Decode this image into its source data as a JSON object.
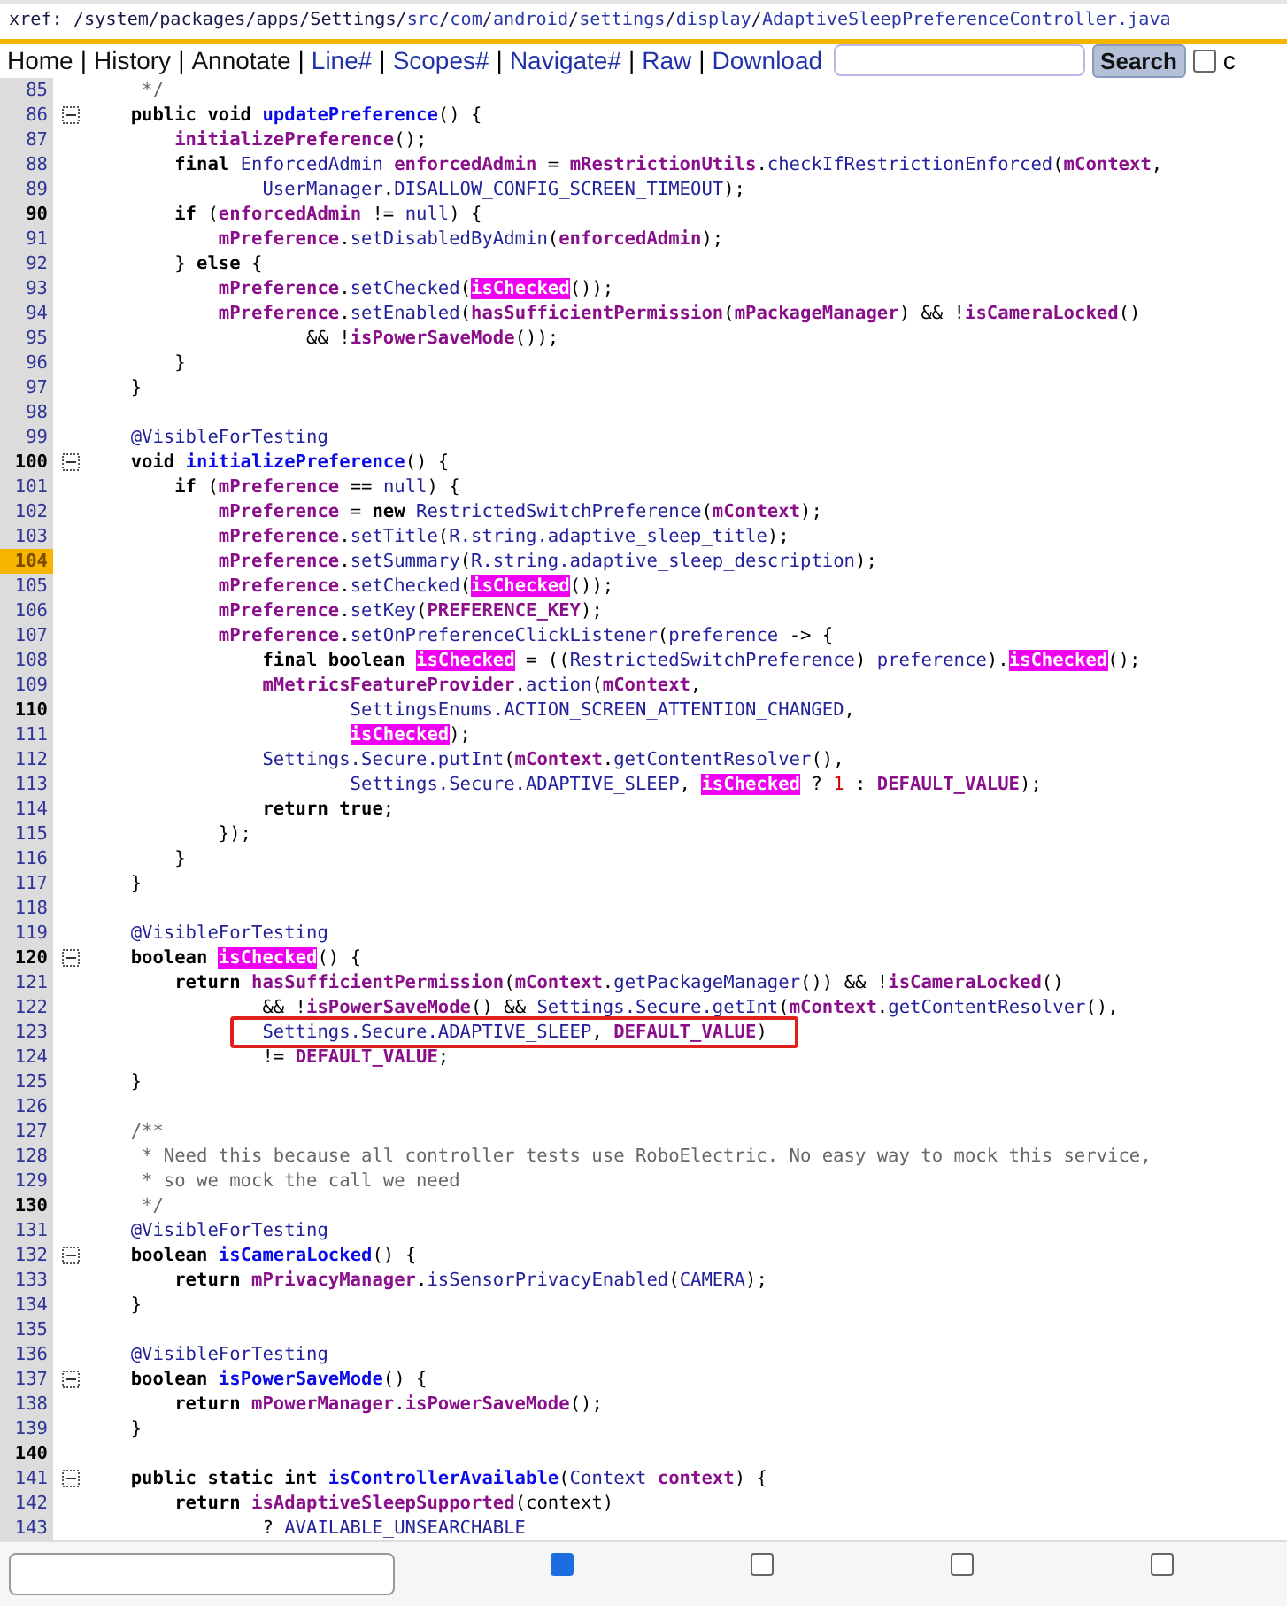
{
  "path": [
    {
      "text": "xref: /system/packages/apps/Settings/",
      "link": false
    },
    {
      "text": "src",
      "link": true
    },
    {
      "text": "/",
      "link": false
    },
    {
      "text": "com",
      "link": true
    },
    {
      "text": "/",
      "link": false
    },
    {
      "text": "android",
      "link": true
    },
    {
      "text": "/",
      "link": false
    },
    {
      "text": "settings",
      "link": true
    },
    {
      "text": "/",
      "link": false
    },
    {
      "text": "display",
      "link": true
    },
    {
      "text": "/",
      "link": false
    },
    {
      "text": "AdaptiveSleepPreferenceController.java",
      "link": true
    }
  ],
  "nav": [
    {
      "kind": "page",
      "label": "Home"
    },
    {
      "kind": "sep",
      "label": "|"
    },
    {
      "kind": "page",
      "label": "History"
    },
    {
      "kind": "sep",
      "label": "|"
    },
    {
      "kind": "page",
      "label": "Annotate"
    },
    {
      "kind": "sep",
      "label": "|"
    },
    {
      "kind": "link",
      "label": "Line#"
    },
    {
      "kind": "sep",
      "label": "|"
    },
    {
      "kind": "link",
      "label": "Scopes#"
    },
    {
      "kind": "sep",
      "label": "|"
    },
    {
      "kind": "link",
      "label": "Navigate#"
    },
    {
      "kind": "sep",
      "label": "|"
    },
    {
      "kind": "link",
      "label": "Raw"
    },
    {
      "kind": "sep",
      "label": "|"
    },
    {
      "kind": "link",
      "label": "Download"
    }
  ],
  "search": {
    "button": "Search",
    "checked": false,
    "option_label": "c"
  },
  "lines": [
    {
      "n": "85",
      "kind": "plain",
      "fold": false,
      "tokens": [
        {
          "t": "     */",
          "kind": "c"
        }
      ]
    },
    {
      "n": "86",
      "kind": "plain",
      "fold": true,
      "tokens": [
        {
          "t": "    public void ",
          "kind": "kw"
        },
        {
          "t": "updatePreference",
          "kind": "fn"
        },
        {
          "t": "() {",
          "kind": "p"
        }
      ]
    },
    {
      "n": "87",
      "kind": "plain",
      "fold": false,
      "tokens": [
        {
          "t": "        initializePreference",
          "kind": "f"
        },
        {
          "t": "();",
          "kind": "p"
        }
      ]
    },
    {
      "n": "88",
      "kind": "plain",
      "fold": false,
      "tokens": [
        {
          "t": "        final ",
          "kind": "kw"
        },
        {
          "t": "EnforcedAdmin ",
          "kind": "id"
        },
        {
          "t": "enforcedAdmin",
          "kind": "f"
        },
        {
          "t": " = ",
          "kind": "p"
        },
        {
          "t": "mRestrictionUtils",
          "kind": "f"
        },
        {
          "t": ".",
          "kind": "p"
        },
        {
          "t": "checkIfRestrictionEnforced",
          "kind": "id"
        },
        {
          "t": "(",
          "kind": "p"
        },
        {
          "t": "mContext",
          "kind": "f"
        },
        {
          "t": ",",
          "kind": "p"
        }
      ]
    },
    {
      "n": "89",
      "kind": "plain",
      "fold": false,
      "tokens": [
        {
          "t": "                UserManager",
          "kind": "id"
        },
        {
          "t": ".",
          "kind": "p"
        },
        {
          "t": "DISALLOW_CONFIG_SCREEN_TIMEOUT",
          "kind": "id"
        },
        {
          "t": ");",
          "kind": "p"
        }
      ]
    },
    {
      "n": "90",
      "kind": "bold",
      "fold": false,
      "tokens": [
        {
          "t": "        if",
          "kind": "kw"
        },
        {
          "t": " (",
          "kind": "p"
        },
        {
          "t": "enforcedAdmin",
          "kind": "f"
        },
        {
          "t": " != ",
          "kind": "p"
        },
        {
          "t": "null",
          "kind": "id"
        },
        {
          "t": ") {",
          "kind": "p"
        }
      ]
    },
    {
      "n": "91",
      "kind": "plain",
      "fold": false,
      "tokens": [
        {
          "t": "            mPreference",
          "kind": "f"
        },
        {
          "t": ".",
          "kind": "p"
        },
        {
          "t": "setDisabledByAdmin",
          "kind": "id"
        },
        {
          "t": "(",
          "kind": "p"
        },
        {
          "t": "enforcedAdmin",
          "kind": "f"
        },
        {
          "t": ");",
          "kind": "p"
        }
      ]
    },
    {
      "n": "92",
      "kind": "plain",
      "fold": false,
      "tokens": [
        {
          "t": "        } ",
          "kind": "p"
        },
        {
          "t": "else",
          "kind": "kw"
        },
        {
          "t": " {",
          "kind": "p"
        }
      ]
    },
    {
      "n": "93",
      "kind": "plain",
      "fold": false,
      "tokens": [
        {
          "t": "            mPreference",
          "kind": "f"
        },
        {
          "t": ".",
          "kind": "p"
        },
        {
          "t": "setChecked",
          "kind": "id"
        },
        {
          "t": "(",
          "kind": "p"
        },
        {
          "t": "isChecked",
          "kind": "hit"
        },
        {
          "t": "());",
          "kind": "p"
        }
      ]
    },
    {
      "n": "94",
      "kind": "plain",
      "fold": false,
      "tokens": [
        {
          "t": "            mPreference",
          "kind": "f"
        },
        {
          "t": ".",
          "kind": "p"
        },
        {
          "t": "setEnabled",
          "kind": "id"
        },
        {
          "t": "(",
          "kind": "p"
        },
        {
          "t": "hasSufficientPermission",
          "kind": "f"
        },
        {
          "t": "(",
          "kind": "p"
        },
        {
          "t": "mPackageManager",
          "kind": "f"
        },
        {
          "t": ") && !",
          "kind": "p"
        },
        {
          "t": "isCameraLocked",
          "kind": "f"
        },
        {
          "t": "()",
          "kind": "p"
        }
      ]
    },
    {
      "n": "95",
      "kind": "plain",
      "fold": false,
      "tokens": [
        {
          "t": "                    && !",
          "kind": "p"
        },
        {
          "t": "isPowerSaveMode",
          "kind": "f"
        },
        {
          "t": "());",
          "kind": "p"
        }
      ]
    },
    {
      "n": "96",
      "kind": "plain",
      "fold": false,
      "tokens": [
        {
          "t": "        }",
          "kind": "p"
        }
      ]
    },
    {
      "n": "97",
      "kind": "plain",
      "fold": false,
      "tokens": [
        {
          "t": "    }",
          "kind": "p"
        }
      ]
    },
    {
      "n": "98",
      "kind": "plain",
      "fold": false
    },
    {
      "n": "99",
      "kind": "plain",
      "fold": false,
      "tokens": [
        {
          "t": "    @VisibleForTesting",
          "kind": "id"
        }
      ]
    },
    {
      "n": "100",
      "kind": "bold",
      "fold": true,
      "tokens": [
        {
          "t": "    void ",
          "kind": "kw"
        },
        {
          "t": "initializePreference",
          "kind": "fn"
        },
        {
          "t": "() {",
          "kind": "p"
        }
      ]
    },
    {
      "n": "101",
      "kind": "plain",
      "fold": false,
      "tokens": [
        {
          "t": "        if",
          "kind": "kw"
        },
        {
          "t": " (",
          "kind": "p"
        },
        {
          "t": "mPreference",
          "kind": "f"
        },
        {
          "t": " == ",
          "kind": "p"
        },
        {
          "t": "null",
          "kind": "id"
        },
        {
          "t": ") {",
          "kind": "p"
        }
      ]
    },
    {
      "n": "102",
      "kind": "plain",
      "fold": false,
      "tokens": [
        {
          "t": "            mPreference",
          "kind": "f"
        },
        {
          "t": " = ",
          "kind": "p"
        },
        {
          "t": "new ",
          "kind": "kw"
        },
        {
          "t": "RestrictedSwitchPreference",
          "kind": "id"
        },
        {
          "t": "(",
          "kind": "p"
        },
        {
          "t": "mContext",
          "kind": "f"
        },
        {
          "t": ");",
          "kind": "p"
        }
      ]
    },
    {
      "n": "103",
      "kind": "plain",
      "fold": false,
      "tokens": [
        {
          "t": "            mPreference",
          "kind": "f"
        },
        {
          "t": ".",
          "kind": "p"
        },
        {
          "t": "setTitle",
          "kind": "id"
        },
        {
          "t": "(",
          "kind": "p"
        },
        {
          "t": "R.string.adaptive_sleep_title",
          "kind": "id"
        },
        {
          "t": ");",
          "kind": "p"
        }
      ]
    },
    {
      "n": "104",
      "kind": "current",
      "fold": false,
      "tokens": [
        {
          "t": "            mPreference",
          "kind": "f"
        },
        {
          "t": ".",
          "kind": "p"
        },
        {
          "t": "setSummary",
          "kind": "id"
        },
        {
          "t": "(",
          "kind": "p"
        },
        {
          "t": "R.string.adaptive_sleep_description",
          "kind": "id"
        },
        {
          "t": ");",
          "kind": "p"
        }
      ]
    },
    {
      "n": "105",
      "kind": "plain",
      "fold": false,
      "tokens": [
        {
          "t": "            mPreference",
          "kind": "f"
        },
        {
          "t": ".",
          "kind": "p"
        },
        {
          "t": "setChecked",
          "kind": "id"
        },
        {
          "t": "(",
          "kind": "p"
        },
        {
          "t": "isChecked",
          "kind": "hit"
        },
        {
          "t": "());",
          "kind": "p"
        }
      ]
    },
    {
      "n": "106",
      "kind": "plain",
      "fold": false,
      "tokens": [
        {
          "t": "            mPreference",
          "kind": "f"
        },
        {
          "t": ".",
          "kind": "p"
        },
        {
          "t": "setKey",
          "kind": "id"
        },
        {
          "t": "(",
          "kind": "p"
        },
        {
          "t": "PREFERENCE_KEY",
          "kind": "f"
        },
        {
          "t": ");",
          "kind": "p"
        }
      ]
    },
    {
      "n": "107",
      "kind": "plain",
      "fold": false,
      "tokens": [
        {
          "t": "            mPreference",
          "kind": "f"
        },
        {
          "t": ".",
          "kind": "p"
        },
        {
          "t": "setOnPreferenceClickListener",
          "kind": "id"
        },
        {
          "t": "(",
          "kind": "p"
        },
        {
          "t": "preference",
          "kind": "id"
        },
        {
          "t": " -> {",
          "kind": "p"
        }
      ]
    },
    {
      "n": "108",
      "kind": "plain",
      "fold": false,
      "tokens": [
        {
          "t": "                final boolean ",
          "kind": "kw"
        },
        {
          "t": "isChecked",
          "kind": "hit"
        },
        {
          "t": " = ((",
          "kind": "p"
        },
        {
          "t": "RestrictedSwitchPreference",
          "kind": "id"
        },
        {
          "t": ") ",
          "kind": "p"
        },
        {
          "t": "preference",
          "kind": "id"
        },
        {
          "t": ").",
          "kind": "p"
        },
        {
          "t": "isChecked",
          "kind": "hit"
        },
        {
          "t": "();",
          "kind": "p"
        }
      ]
    },
    {
      "n": "109",
      "kind": "plain",
      "fold": false,
      "tokens": [
        {
          "t": "                mMetricsFeatureProvider",
          "kind": "f"
        },
        {
          "t": ".",
          "kind": "p"
        },
        {
          "t": "action",
          "kind": "id"
        },
        {
          "t": "(",
          "kind": "p"
        },
        {
          "t": "mContext",
          "kind": "f"
        },
        {
          "t": ",",
          "kind": "p"
        }
      ]
    },
    {
      "n": "110",
      "kind": "bold",
      "fold": false,
      "tokens": [
        {
          "t": "                        SettingsEnums.ACTION_SCREEN_ATTENTION_CHANGED",
          "kind": "id"
        },
        {
          "t": ",",
          "kind": "p"
        }
      ]
    },
    {
      "n": "111",
      "kind": "plain",
      "fold": false,
      "tokens": [
        {
          "t": "                        isChecked",
          "kind": "hit"
        },
        {
          "t": ");",
          "kind": "p"
        }
      ]
    },
    {
      "n": "112",
      "kind": "plain",
      "fold": false,
      "tokens": [
        {
          "t": "                Settings.Secure.putInt",
          "kind": "id"
        },
        {
          "t": "(",
          "kind": "p"
        },
        {
          "t": "mContext",
          "kind": "f"
        },
        {
          "t": ".",
          "kind": "p"
        },
        {
          "t": "getContentResolver",
          "kind": "id"
        },
        {
          "t": "(),",
          "kind": "p"
        }
      ]
    },
    {
      "n": "113",
      "kind": "plain",
      "fold": false,
      "tokens": [
        {
          "t": "                        Settings.Secure.ADAPTIVE_SLEEP",
          "kind": "id"
        },
        {
          "t": ", ",
          "kind": "p"
        },
        {
          "t": "isChecked",
          "kind": "hit"
        },
        {
          "t": " ? ",
          "kind": "p"
        },
        {
          "t": "1",
          "kind": "n"
        },
        {
          "t": " : ",
          "kind": "p"
        },
        {
          "t": "DEFAULT_VALUE",
          "kind": "f"
        },
        {
          "t": ");",
          "kind": "p"
        }
      ]
    },
    {
      "n": "114",
      "kind": "plain",
      "fold": false,
      "tokens": [
        {
          "t": "                return true",
          "kind": "kw"
        },
        {
          "t": ";",
          "kind": "p"
        }
      ]
    },
    {
      "n": "115",
      "kind": "plain",
      "fold": false,
      "tokens": [
        {
          "t": "            });",
          "kind": "p"
        }
      ]
    },
    {
      "n": "116",
      "kind": "plain",
      "fold": false,
      "tokens": [
        {
          "t": "        }",
          "kind": "p"
        }
      ]
    },
    {
      "n": "117",
      "kind": "plain",
      "fold": false,
      "tokens": [
        {
          "t": "    }",
          "kind": "p"
        }
      ]
    },
    {
      "n": "118",
      "kind": "plain",
      "fold": false
    },
    {
      "n": "119",
      "kind": "plain",
      "fold": false,
      "tokens": [
        {
          "t": "    @VisibleForTesting",
          "kind": "id"
        }
      ]
    },
    {
      "n": "120",
      "kind": "bold",
      "fold": true,
      "tokens": [
        {
          "t": "    boolean ",
          "kind": "kw"
        },
        {
          "t": "isChecked",
          "kind": "hit"
        },
        {
          "t": "() {",
          "kind": "p"
        }
      ]
    },
    {
      "n": "121",
      "kind": "plain",
      "fold": false,
      "tokens": [
        {
          "t": "        return ",
          "kind": "kw"
        },
        {
          "t": "hasSufficientPermission",
          "kind": "f"
        },
        {
          "t": "(",
          "kind": "p"
        },
        {
          "t": "mContext",
          "kind": "f"
        },
        {
          "t": ".",
          "kind": "p"
        },
        {
          "t": "getPackageManager",
          "kind": "id"
        },
        {
          "t": "()) && !",
          "kind": "p"
        },
        {
          "t": "isCameraLocked",
          "kind": "f"
        },
        {
          "t": "()",
          "kind": "p"
        }
      ]
    },
    {
      "n": "122",
      "kind": "plain",
      "fold": false,
      "tokens": [
        {
          "t": "                && !",
          "kind": "p"
        },
        {
          "t": "isPowerSaveMode",
          "kind": "f"
        },
        {
          "t": "() && ",
          "kind": "p"
        },
        {
          "t": "Settings.Secure.getInt",
          "kind": "id"
        },
        {
          "t": "(",
          "kind": "p"
        },
        {
          "t": "mContext",
          "kind": "f"
        },
        {
          "t": ".",
          "kind": "p"
        },
        {
          "t": "getContentResolver",
          "kind": "id"
        },
        {
          "t": "(),",
          "kind": "p"
        }
      ]
    },
    {
      "n": "123",
      "kind": "plain",
      "fold": false,
      "tokens": [
        {
          "kind": "box",
          "children": [
            {
              "t": "                Settings.Secure.ADAPTIVE_SLEEP",
              "kind": "id"
            },
            {
              "t": ", ",
              "kind": "p"
            },
            {
              "t": "DEFAULT_VALUE",
              "kind": "f"
            },
            {
              "t": ")",
              "kind": "p"
            }
          ]
        }
      ]
    },
    {
      "n": "124",
      "kind": "plain",
      "fold": false,
      "tokens": [
        {
          "t": "                != ",
          "kind": "p"
        },
        {
          "t": "DEFAULT_VALUE",
          "kind": "f"
        },
        {
          "t": ";",
          "kind": "p"
        }
      ]
    },
    {
      "n": "125",
      "kind": "plain",
      "fold": false,
      "tokens": [
        {
          "t": "    }",
          "kind": "p"
        }
      ]
    },
    {
      "n": "126",
      "kind": "plain",
      "fold": false
    },
    {
      "n": "127",
      "kind": "plain",
      "fold": false,
      "tokens": [
        {
          "t": "    /**",
          "kind": "c"
        }
      ]
    },
    {
      "n": "128",
      "kind": "plain",
      "fold": false,
      "tokens": [
        {
          "t": "     * Need this because all controller tests use RoboElectric. No easy way to mock this service,",
          "kind": "c"
        }
      ]
    },
    {
      "n": "129",
      "kind": "plain",
      "fold": false,
      "tokens": [
        {
          "t": "     * so we mock the call we need",
          "kind": "c"
        }
      ]
    },
    {
      "n": "130",
      "kind": "bold",
      "fold": false,
      "tokens": [
        {
          "t": "     */",
          "kind": "c"
        }
      ]
    },
    {
      "n": "131",
      "kind": "plain",
      "fold": false,
      "tokens": [
        {
          "t": "    @VisibleForTesting",
          "kind": "id"
        }
      ]
    },
    {
      "n": "132",
      "kind": "plain",
      "fold": true,
      "tokens": [
        {
          "t": "    boolean ",
          "kind": "kw"
        },
        {
          "t": "isCameraLocked",
          "kind": "fn"
        },
        {
          "t": "() {",
          "kind": "p"
        }
      ]
    },
    {
      "n": "133",
      "kind": "plain",
      "fold": false,
      "tokens": [
        {
          "t": "        return ",
          "kind": "kw"
        },
        {
          "t": "mPrivacyManager",
          "kind": "f"
        },
        {
          "t": ".",
          "kind": "p"
        },
        {
          "t": "isSensorPrivacyEnabled",
          "kind": "id"
        },
        {
          "t": "(",
          "kind": "p"
        },
        {
          "t": "CAMERA",
          "kind": "id"
        },
        {
          "t": ");",
          "kind": "p"
        }
      ]
    },
    {
      "n": "134",
      "kind": "plain",
      "fold": false,
      "tokens": [
        {
          "t": "    }",
          "kind": "p"
        }
      ]
    },
    {
      "n": "135",
      "kind": "plain",
      "fold": false
    },
    {
      "n": "136",
      "kind": "plain",
      "fold": false,
      "tokens": [
        {
          "t": "    @VisibleForTesting",
          "kind": "id"
        }
      ]
    },
    {
      "n": "137",
      "kind": "plain",
      "fold": true,
      "tokens": [
        {
          "t": "    boolean ",
          "kind": "kw"
        },
        {
          "t": "isPowerSaveMode",
          "kind": "fn"
        },
        {
          "t": "() {",
          "kind": "p"
        }
      ]
    },
    {
      "n": "138",
      "kind": "plain",
      "fold": false,
      "tokens": [
        {
          "t": "        return ",
          "kind": "kw"
        },
        {
          "t": "mPowerManager",
          "kind": "f"
        },
        {
          "t": ".",
          "kind": "p"
        },
        {
          "t": "isPowerSaveMode",
          "kind": "f"
        },
        {
          "t": "();",
          "kind": "p"
        }
      ]
    },
    {
      "n": "139",
      "kind": "plain",
      "fold": false,
      "tokens": [
        {
          "t": "    }",
          "kind": "p"
        }
      ]
    },
    {
      "n": "140",
      "kind": "bold",
      "fold": false
    },
    {
      "n": "141",
      "kind": "plain",
      "fold": true,
      "tokens": [
        {
          "t": "    public static int ",
          "kind": "kw"
        },
        {
          "t": "isControllerAvailable",
          "kind": "fn"
        },
        {
          "t": "(",
          "kind": "p"
        },
        {
          "t": "Context ",
          "kind": "id"
        },
        {
          "t": "context",
          "kind": "f"
        },
        {
          "t": ") {",
          "kind": "p"
        }
      ]
    },
    {
      "n": "142",
      "kind": "plain",
      "fold": false,
      "tokens": [
        {
          "t": "        return ",
          "kind": "kw"
        },
        {
          "t": "isAdaptiveSleepSupported",
          "kind": "f"
        },
        {
          "t": "(context)",
          "kind": "p"
        }
      ]
    },
    {
      "n": "143",
      "kind": "plain",
      "fold": false,
      "tokens": [
        {
          "t": "                ? ",
          "kind": "p"
        },
        {
          "t": "AVAILABLE_UNSEARCHABLE",
          "kind": "id"
        }
      ]
    }
  ],
  "bottom_options": [
    {
      "checked": true
    },
    {
      "checked": false
    },
    {
      "checked": false
    },
    {
      "checked": false
    }
  ]
}
